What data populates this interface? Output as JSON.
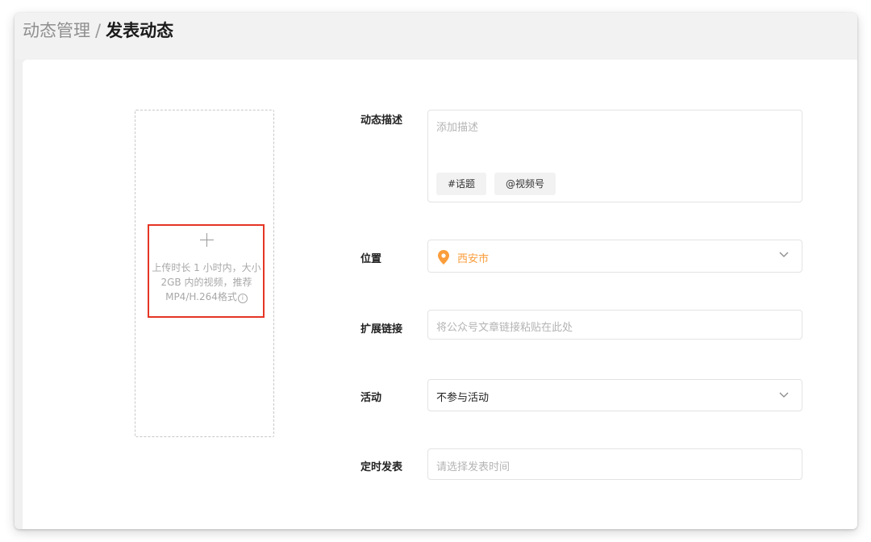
{
  "breadcrumb": {
    "parent": "动态管理",
    "separator": "/",
    "current": "发表动态"
  },
  "upload": {
    "hint": "上传时长 1 小时内，大小 2GB 内的视频，推荐MP4/H.264格式",
    "info_glyph": "i"
  },
  "form": {
    "description": {
      "label": "动态描述",
      "placeholder": "添加描述",
      "topic_button": "#话题",
      "channel_button": "@视频号"
    },
    "location": {
      "label": "位置",
      "value": "西安市"
    },
    "extended_link": {
      "label": "扩展链接",
      "placeholder": "将公众号文章链接粘贴在此处"
    },
    "activity": {
      "label": "活动",
      "value": "不参与活动"
    },
    "schedule": {
      "label": "定时发表",
      "placeholder": "请选择发表时间"
    }
  },
  "colors": {
    "accent_orange": "#fa9d3b",
    "highlight_red": "#e53524"
  }
}
